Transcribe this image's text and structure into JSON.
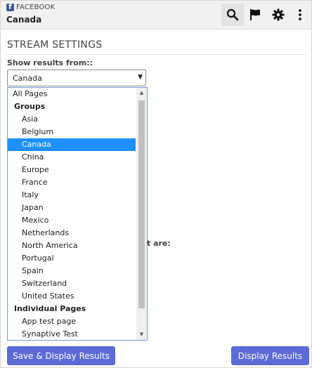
{
  "header": {
    "brand": "FACEBOOK",
    "page_name": "Canada",
    "icons": [
      "search-icon",
      "flag-icon",
      "gear-icon",
      "more-vertical-icon"
    ]
  },
  "section": {
    "title": "STREAM SETTINGS",
    "label": "Show results from::",
    "select_value": "Canada"
  },
  "dropdown": {
    "options": [
      {
        "label": "All Pages",
        "kind": "top"
      },
      {
        "label": "Groups",
        "kind": "group"
      },
      {
        "label": "Asia",
        "kind": "item"
      },
      {
        "label": "Belgium",
        "kind": "item"
      },
      {
        "label": "Canada",
        "kind": "item",
        "selected": true
      },
      {
        "label": "China",
        "kind": "item"
      },
      {
        "label": "Europe",
        "kind": "item"
      },
      {
        "label": "France",
        "kind": "item"
      },
      {
        "label": "Italy",
        "kind": "item"
      },
      {
        "label": "Japan",
        "kind": "item"
      },
      {
        "label": "Mexico",
        "kind": "item"
      },
      {
        "label": "Netherlands",
        "kind": "item"
      },
      {
        "label": "North America",
        "kind": "item"
      },
      {
        "label": "Portugal",
        "kind": "item"
      },
      {
        "label": "Spain",
        "kind": "item"
      },
      {
        "label": "Switzerland",
        "kind": "item"
      },
      {
        "label": "United States",
        "kind": "item"
      },
      {
        "label": "Individual Pages",
        "kind": "group"
      },
      {
        "label": "App test page",
        "kind": "item"
      },
      {
        "label": "Synaptive Test",
        "kind": "item"
      }
    ]
  },
  "hidden_label_fragment": "t are:",
  "buttons": {
    "save": "Save & Display Results",
    "display": "Display Results"
  },
  "colors": {
    "accent": "#5c6bd6",
    "selection": "#1e90ff",
    "facebook": "#3b5998"
  }
}
